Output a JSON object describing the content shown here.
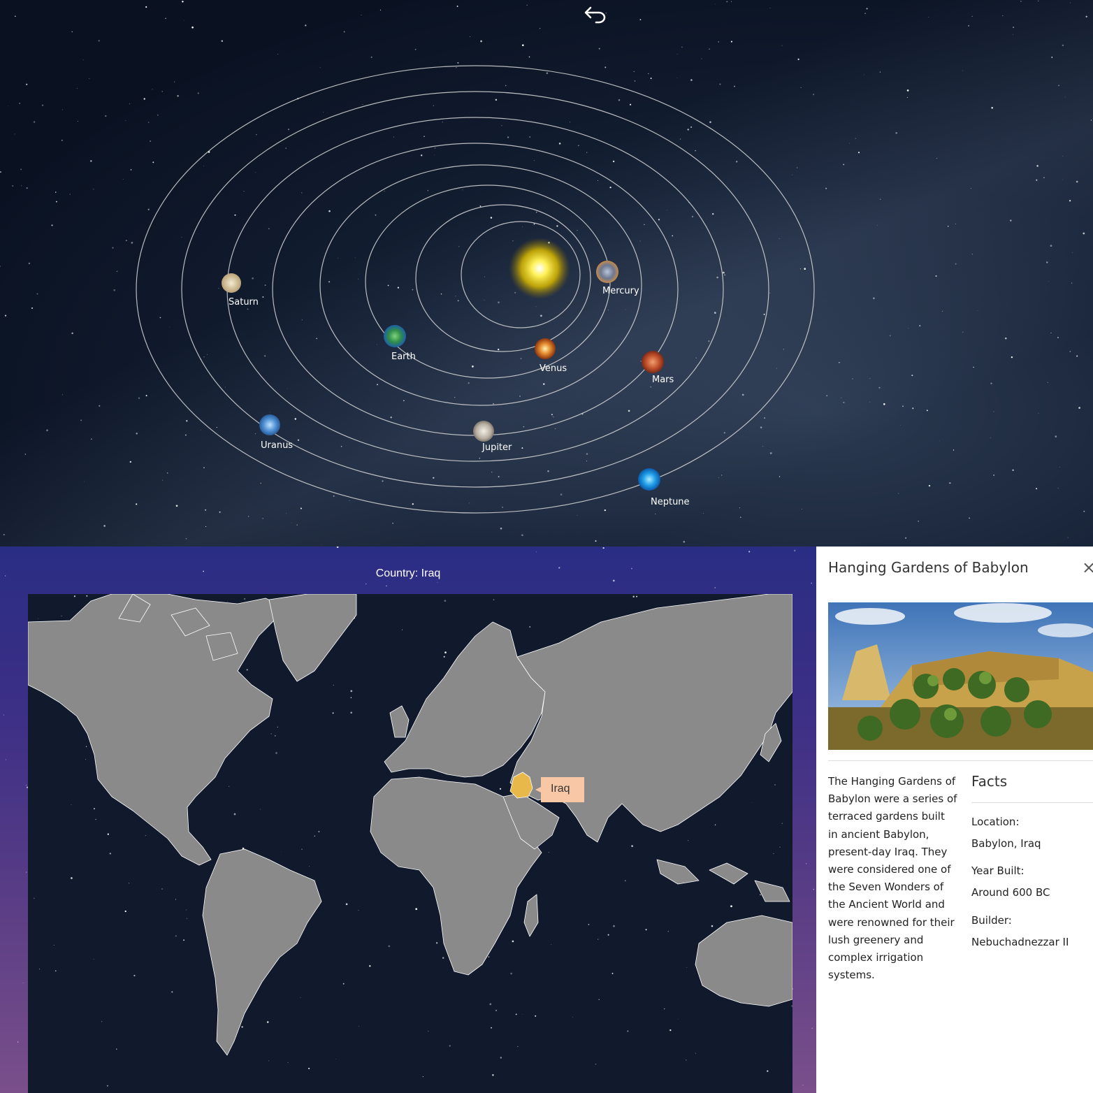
{
  "solar": {
    "back_icon": "undo-arrow-icon",
    "planets": [
      {
        "name": "Saturn"
      },
      {
        "name": "Mercury"
      },
      {
        "name": "Earth"
      },
      {
        "name": "Venus"
      },
      {
        "name": "Mars"
      },
      {
        "name": "Uranus"
      },
      {
        "name": "Jupiter"
      },
      {
        "name": "Neptune"
      }
    ]
  },
  "map_view": {
    "title": "Country: Iraq",
    "tooltip": "Iraq",
    "highlight_color": "#e8b84a",
    "land_color": "#8a8a8a",
    "tooltip_color": "#f8c7a6"
  },
  "panel": {
    "title": "Hanging Gardens of Babylon",
    "close_icon": "close-icon",
    "description": "The Hanging Gardens of Babylon were a series of terraced gardens built in ancient Babylon, present-day Iraq. They were considered one of the Seven Wonders of the Ancient World and were renowned for their lush greenery and complex irrigation systems.",
    "facts_title": "Facts",
    "facts": [
      {
        "label": "Location:",
        "value": "Babylon, Iraq"
      },
      {
        "label": "Year Built:",
        "value": "Around 600 BC"
      },
      {
        "label": "Builder:",
        "value": "Nebuchadnezzar II"
      }
    ]
  }
}
